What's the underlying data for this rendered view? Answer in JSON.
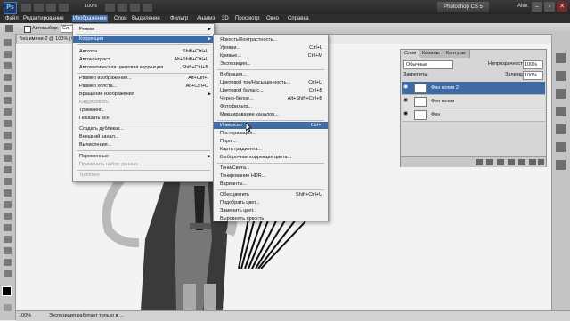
{
  "colors": {
    "accent": "#3f6ba5",
    "menu_bg": "#f0f0f0",
    "titlebar": "#2e2e2e"
  },
  "titlebar": {
    "logo": "Ps",
    "app_name": "Photoshop CS 5",
    "user": "Alex",
    "zoom": "100%",
    "min_glyph": "–",
    "max_glyph": "▫",
    "close_glyph": "✕"
  },
  "menubar": [
    "Файл",
    "Редактирование",
    "Изображение",
    "Слои",
    "Выделение",
    "Фильтр",
    "Анализ",
    "3D",
    "Просмотр",
    "Окно",
    "Справка"
  ],
  "options": {
    "autoselect": "Автовыбор:",
    "autoselect_value": "Сл"
  },
  "document": {
    "tab": "Без имени-2 @ 100% (Фон ко"
  },
  "status": {
    "zoom": "100%",
    "message": "Экспозиция работает только в ..."
  },
  "image_menu": [
    {
      "label": "Режим",
      "arrow": "▶"
    },
    {
      "label": "Коррекция",
      "arrow": "▶",
      "highlighted": true
    },
    {
      "label": "Автотон",
      "shortcut": "Shift+Ctrl+L"
    },
    {
      "label": "Автоконтраст",
      "shortcut": "Alt+Shift+Ctrl+L"
    },
    {
      "label": "Автоматическая цветовая коррекция",
      "shortcut": "Shift+Ctrl+B"
    },
    {
      "label": "Размер изображения...",
      "shortcut": "Alt+Ctrl+I"
    },
    {
      "label": "Размер холста...",
      "shortcut": "Alt+Ctrl+C"
    },
    {
      "label": "Вращение изображения",
      "arrow": "▶"
    },
    {
      "label": "Кадрировать",
      "disabled": true
    },
    {
      "label": "Тримминг..."
    },
    {
      "label": "Показать все"
    },
    {
      "label": "Создать дубликат..."
    },
    {
      "label": "Внешний канал..."
    },
    {
      "label": "Вычисления..."
    },
    {
      "label": "Переменные",
      "arrow": "▶"
    },
    {
      "label": "Применить набор данных...",
      "disabled": true
    },
    {
      "label": "Треппинг",
      "disabled": true
    }
  ],
  "adjust_menu": [
    {
      "label": "Яркость/Контрастность..."
    },
    {
      "label": "Уровни...",
      "shortcut": "Ctrl+L"
    },
    {
      "label": "Кривые...",
      "shortcut": "Ctrl+M"
    },
    {
      "label": "Экспозиция..."
    },
    {
      "label": "Вибрация..."
    },
    {
      "label": "Цветовой тон/Насыщенность...",
      "shortcut": "Ctrl+U"
    },
    {
      "label": "Цветовой баланс...",
      "shortcut": "Ctrl+B"
    },
    {
      "label": "Черно-белое...",
      "shortcut": "Alt+Shift+Ctrl+B"
    },
    {
      "label": "Фотофильтр..."
    },
    {
      "label": "Микширование каналов..."
    },
    {
      "label": "Инверсия",
      "shortcut": "Ctrl+I",
      "highlighted": true
    },
    {
      "label": "Постеризация..."
    },
    {
      "label": "Порог..."
    },
    {
      "label": "Карта градиента..."
    },
    {
      "label": "Выборочная коррекция цвета..."
    },
    {
      "label": "Тени/Света..."
    },
    {
      "label": "Тонирование HDR..."
    },
    {
      "label": "Варианты..."
    },
    {
      "label": "Обесцветить",
      "shortcut": "Shift+Ctrl+U"
    },
    {
      "label": "Подобрать цвет..."
    },
    {
      "label": "Заменить цвет..."
    },
    {
      "label": "Выровнять яркость"
    }
  ],
  "layers_panel": {
    "tabs": [
      "Слои",
      "Каналы",
      "Контуры"
    ],
    "blend_mode": "Обычные",
    "opacity_label": "Непрозрачность:",
    "opacity_value": "100%",
    "lock_label": "Закрепить:",
    "fill_label": "Заливка:",
    "fill_value": "100%",
    "layers": [
      {
        "name": "Фон копия 2",
        "selected": true
      },
      {
        "name": "Фон копия",
        "selected": false
      },
      {
        "name": "Фон",
        "selected": false
      }
    ]
  }
}
